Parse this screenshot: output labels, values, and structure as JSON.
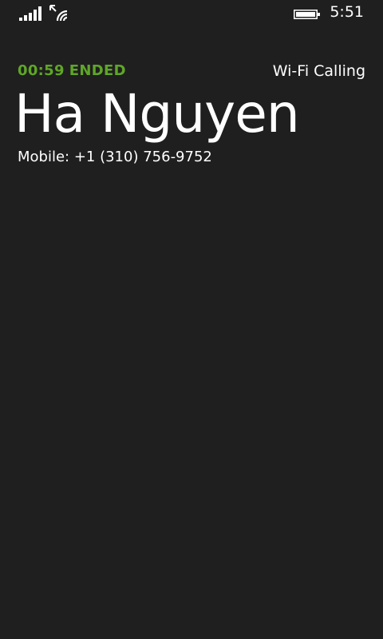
{
  "status_bar": {
    "time": "5:51",
    "signal_icon": "signal-bars-icon",
    "wifi_icon": "wifi-calling-icon",
    "battery_icon": "battery-icon"
  },
  "call": {
    "duration": "00:59",
    "state": "ENDED",
    "mode": "Wi-Fi Calling",
    "accent_color": "#5fa628"
  },
  "contact": {
    "name": "Ha Nguyen",
    "number_line": "Mobile: +1 (310) 756-9752"
  }
}
